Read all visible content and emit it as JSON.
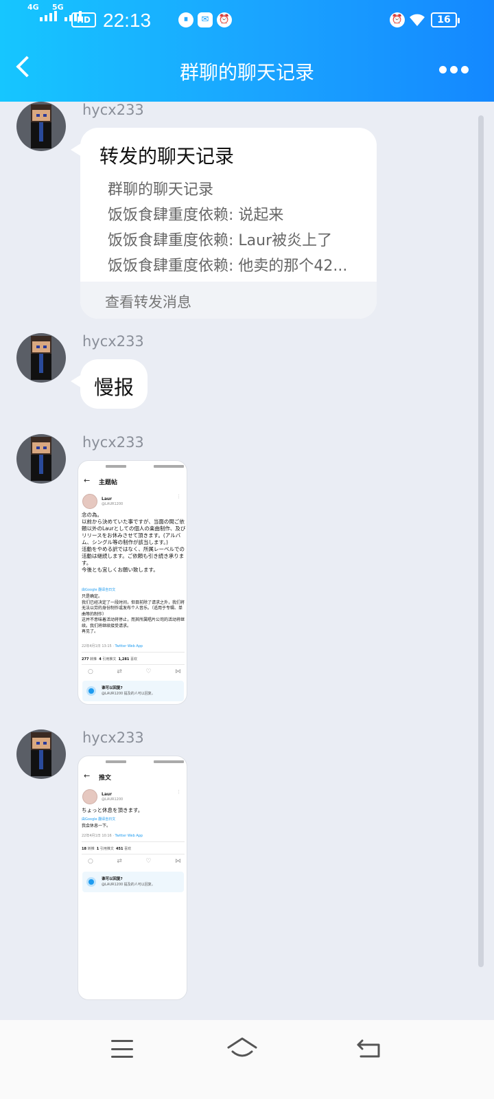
{
  "status_bar": {
    "sim1": "4G",
    "sim2": "5G",
    "hd": "HD",
    "time": "22:13",
    "battery": "16"
  },
  "header": {
    "title": "群聊的聊天记录"
  },
  "messages": [
    {
      "sender": "hycx233",
      "type": "forward",
      "forward_title": "转发的聊天记录",
      "lines": [
        "群聊的聊天记录",
        "饭饭食肆重度依赖: 说起来",
        "饭饭食肆重度依赖: Laur被炎上了",
        "饭饭食肆重度依赖: 他卖的那个42..."
      ],
      "footer": "查看转发消息"
    },
    {
      "sender": "hycx233",
      "type": "text",
      "text": "慢报"
    },
    {
      "sender": "hycx233",
      "type": "image",
      "screenshot": {
        "title": "主题帖",
        "user": "Laur",
        "handle": "@LAUR1200",
        "jp_text": "念の為。\n以前から決めていた事ですが、当面の間ご依頼以外のLaurとしての個人の楽曲制作、及びリリースをお休みさせて頂きます。(アルバム、シングル等の制作が該当します。)\n活動をやめる訳ではなく、所属レーベルでの活動は継続します。ご依頼も引き続き承ります。\n今後とも宜しくお願い致します。",
        "translate": "由Google 翻译自日文",
        "cn_text": "只是确定。\n我们已经决定了一段时间，但目前除了请求之外，我们将无法以劳的身份制作或发布个人音乐。（适用于专辑、单曲等的制作）\n这并不意味着活动将停止，而其所属唱片公司的活动将继续。我们将继续接受请求。\n再见了。",
        "meta": "22年4月1日 13:15 ·",
        "app": "Twitter Web App",
        "stats": [
          {
            "num": "277",
            "label": "转推"
          },
          {
            "num": "4",
            "label": "引用推文"
          },
          {
            "num": "1,281",
            "label": "喜欢"
          }
        ],
        "reply_title": "谁可以回复?",
        "reply_sub": "@LAUR1200 提及的人可以回复。"
      }
    },
    {
      "sender": "hycx233",
      "type": "image",
      "screenshot": {
        "title": "推文",
        "user": "Laur",
        "handle": "@LAUR1200",
        "jp_text": "ちょっと休息を頂きます。",
        "translate": "由Google 翻译自日文",
        "cn_text": "我会休息一下。",
        "meta": "22年4月1日 10:16 ·",
        "app": "Twitter Web App",
        "stats": [
          {
            "num": "18",
            "label": "转推"
          },
          {
            "num": "1",
            "label": "引用推文"
          },
          {
            "num": "451",
            "label": "喜欢"
          }
        ],
        "reply_title": "谁可以回复?",
        "reply_sub": "@LAUR1200 提及的人可以回复。"
      }
    }
  ],
  "icons": {
    "back": "chevron-left-icon",
    "more": "more-dots-icon",
    "nav_menu": "menu-icon",
    "nav_home": "home-icon",
    "nav_back": "back-icon"
  },
  "colors": {
    "header_start": "#16c6ff",
    "header_end": "#1488ff",
    "background": "#eaedf4",
    "bubble": "#ffffff",
    "name": "#8a8f99"
  }
}
